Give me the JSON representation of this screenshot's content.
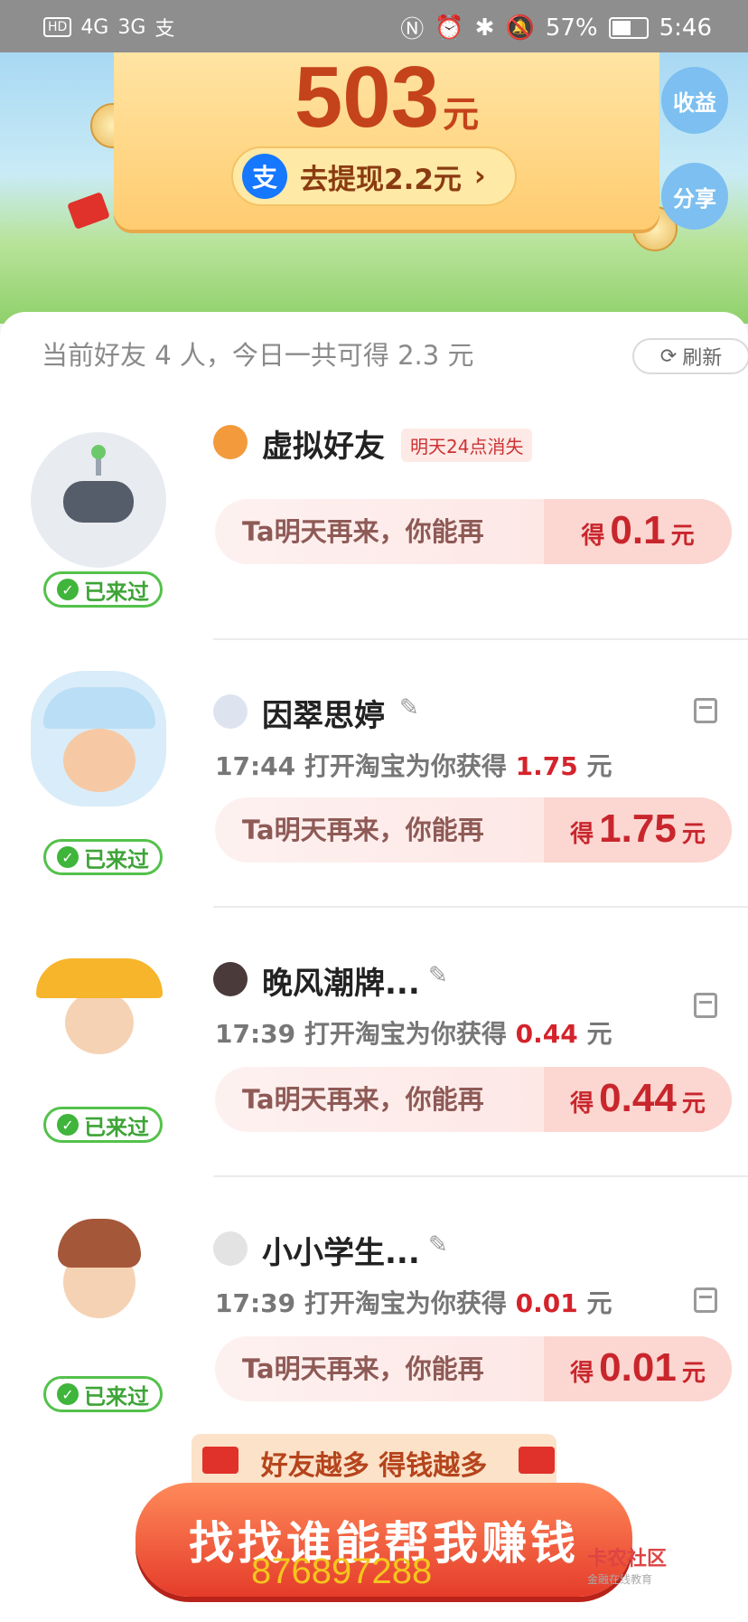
{
  "status_bar": {
    "left_icons": [
      "HD",
      "4G",
      "3G",
      "支"
    ],
    "battery": "57%",
    "time": "5:46"
  },
  "hero": {
    "amount": "503",
    "amount_unit": "元",
    "withdraw_label": "去提现2.2元",
    "withdraw_icon": "支",
    "earnings_button": "收益",
    "share_button": "分享"
  },
  "summary": {
    "text": "当前好友 4 人，今日一共可得 2.3 元",
    "refresh_label": "刷新"
  },
  "friends": [
    {
      "name": "虚拟好友",
      "tag": "明天24点消失",
      "activity": "",
      "activity_amount": "",
      "activity_unit": "",
      "hint": "Ta明天再来，你能再",
      "gain_prefix": "得",
      "gain_value": "0.1",
      "gain_unit": "元",
      "visited": "已来过",
      "avatar": "robot"
    },
    {
      "name": "因翠思婷",
      "tag": "",
      "activity": "17:44 打开淘宝为你获得",
      "activity_amount": "1.75",
      "activity_unit": "元",
      "hint": "Ta明天再来，你能再",
      "gain_prefix": "得",
      "gain_value": "1.75",
      "gain_unit": "元",
      "visited": "已来过",
      "avatar": "boy-hat"
    },
    {
      "name": "晚风潮牌...",
      "tag": "",
      "activity": "17:39 打开淘宝为你获得",
      "activity_amount": "0.44",
      "activity_unit": "元",
      "hint": "Ta明天再来，你能再",
      "gain_prefix": "得",
      "gain_value": "0.44",
      "gain_unit": "元",
      "visited": "已来过",
      "avatar": "boy-yellow-hat"
    },
    {
      "name": "小小学生...",
      "tag": "",
      "activity": "17:39 打开淘宝为你获得",
      "activity_amount": "0.01",
      "activity_unit": "元",
      "hint": "Ta明天再来，你能再",
      "gain_prefix": "得",
      "gain_value": "0.01",
      "gain_unit": "元",
      "visited": "已来过",
      "avatar": "boy"
    }
  ],
  "bottom": {
    "tag": "好友越多 得钱越多",
    "cta": "找找谁能帮我赚钱",
    "overlay_number": "876897288",
    "watermark": "卡农社区",
    "watermark_sub": "金融在线教育"
  },
  "colors": {
    "accent_red": "#d4232b",
    "green": "#3fb53b",
    "gold": "#c4431b"
  }
}
